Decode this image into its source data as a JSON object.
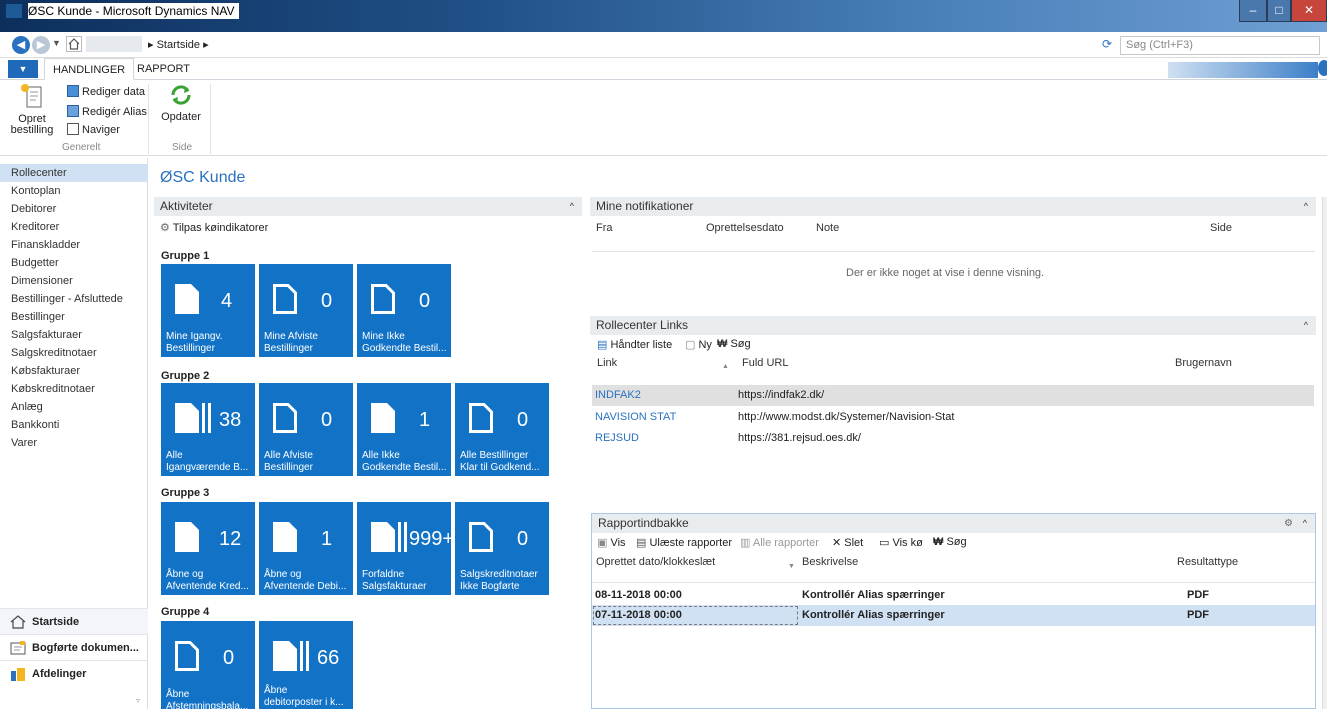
{
  "window": {
    "title": "ØSC Kunde - Microsoft Dynamics NAV",
    "minimize": "–",
    "maximize": "□",
    "close": "✕"
  },
  "address": {
    "crumb1": "Startside",
    "crumb_sep": "▸",
    "search_placeholder": "Søg (Ctrl+F3)"
  },
  "ribbon": {
    "tabs": [
      "HANDLINGER",
      "RAPPORT"
    ],
    "opret_line1": "Opret",
    "opret_line2": "bestilling",
    "rediger_data": "Rediger data",
    "rediger_alias": "Redigér Alias",
    "naviger": "Naviger",
    "group_generelt": "Generelt",
    "opdater": "Opdater",
    "group_side": "Side"
  },
  "nav": {
    "items": [
      "Rollecenter",
      "Kontoplan",
      "Debitorer",
      "Kreditorer",
      "Finanskladder",
      "Budgetter",
      "Dimensioner",
      "Bestillinger - Afsluttede",
      "Bestillinger",
      "Salgsfakturaer",
      "Salgskreditnotaer",
      "Købsfakturaer",
      "Købskreditnotaer",
      "Anlæg",
      "Bankkonti",
      "Varer"
    ],
    "bottom": [
      "Startside",
      "Bogførte dokumen...",
      "Afdelinger"
    ]
  },
  "page": {
    "title": "ØSC Kunde"
  },
  "activities": {
    "header": "Aktiviteter",
    "customize": "Tilpas køindikatorer",
    "group1": "Gruppe 1",
    "group2": "Gruppe 2",
    "group3": "Gruppe 3",
    "group4": "Gruppe 4",
    "tiles": [
      {
        "num": "4",
        "cap1": "Mine Igangv.",
        "cap2": "Bestillinger"
      },
      {
        "num": "0",
        "cap1": "Mine Afviste",
        "cap2": "Bestillinger"
      },
      {
        "num": "0",
        "cap1": "Mine Ikke",
        "cap2": "Godkendte Bestil..."
      },
      {
        "num": "38",
        "cap1": "Alle",
        "cap2": "Igangværende B..."
      },
      {
        "num": "0",
        "cap1": "Alle Afviste",
        "cap2": "Bestillinger"
      },
      {
        "num": "1",
        "cap1": "Alle Ikke",
        "cap2": "Godkendte Bestil..."
      },
      {
        "num": "0",
        "cap1": "Alle Bestillinger",
        "cap2": "Klar til Godkend..."
      },
      {
        "num": "12",
        "cap1": "Åbne og",
        "cap2": "Afventende Kred..."
      },
      {
        "num": "1",
        "cap1": "Åbne og",
        "cap2": "Afventende Debi..."
      },
      {
        "num": "999+",
        "cap1": "Forfaldne",
        "cap2": "Salgsfakturaer"
      },
      {
        "num": "0",
        "cap1": "Salgskreditnotaer",
        "cap2": "Ikke Bogførte"
      },
      {
        "num": "0",
        "cap1": "Åbne",
        "cap2": "Afstemningsbala..."
      },
      {
        "num": "66",
        "cap1": "Åbne",
        "cap2": "debitorposter i k..."
      }
    ]
  },
  "notifications": {
    "header": "Mine notifikationer",
    "cols": [
      "Fra",
      "Oprettelsesdato",
      "Note",
      "Side"
    ],
    "empty": "Der er ikke noget at vise i denne visning."
  },
  "links": {
    "header": "Rollecenter Links",
    "tb_manage": "Håndter liste",
    "tb_new": "Ny",
    "tb_search": "Søg",
    "cols": [
      "Link",
      "Fuld URL",
      "Brugernavn"
    ],
    "rows": [
      {
        "link": "INDFAK2",
        "url": "https://indfak2.dk/"
      },
      {
        "link": "NAVISION STAT",
        "url": "http://www.modst.dk/Systemer/Navision-Stat"
      },
      {
        "link": "REJSUD",
        "url": "https://381.rejsud.oes.dk/"
      }
    ]
  },
  "reports": {
    "header": "Rapportindbakke",
    "tb_vis": "Vis",
    "tb_unread": "Ulæste rapporter",
    "tb_all": "Alle rapporter",
    "tb_delete": "Slet",
    "tb_queue": "Vis kø",
    "tb_search": "Søg",
    "cols": [
      "Oprettet dato/klokkeslæt",
      "Beskrivelse",
      "Resultattype"
    ],
    "rows": [
      {
        "date": "08-11-2018 00:00",
        "desc": "Kontrollér Alias spærringer",
        "type": "PDF"
      },
      {
        "date": "07-11-2018 00:00",
        "desc": "Kontrollér Alias spærringer",
        "type": "PDF"
      }
    ]
  }
}
